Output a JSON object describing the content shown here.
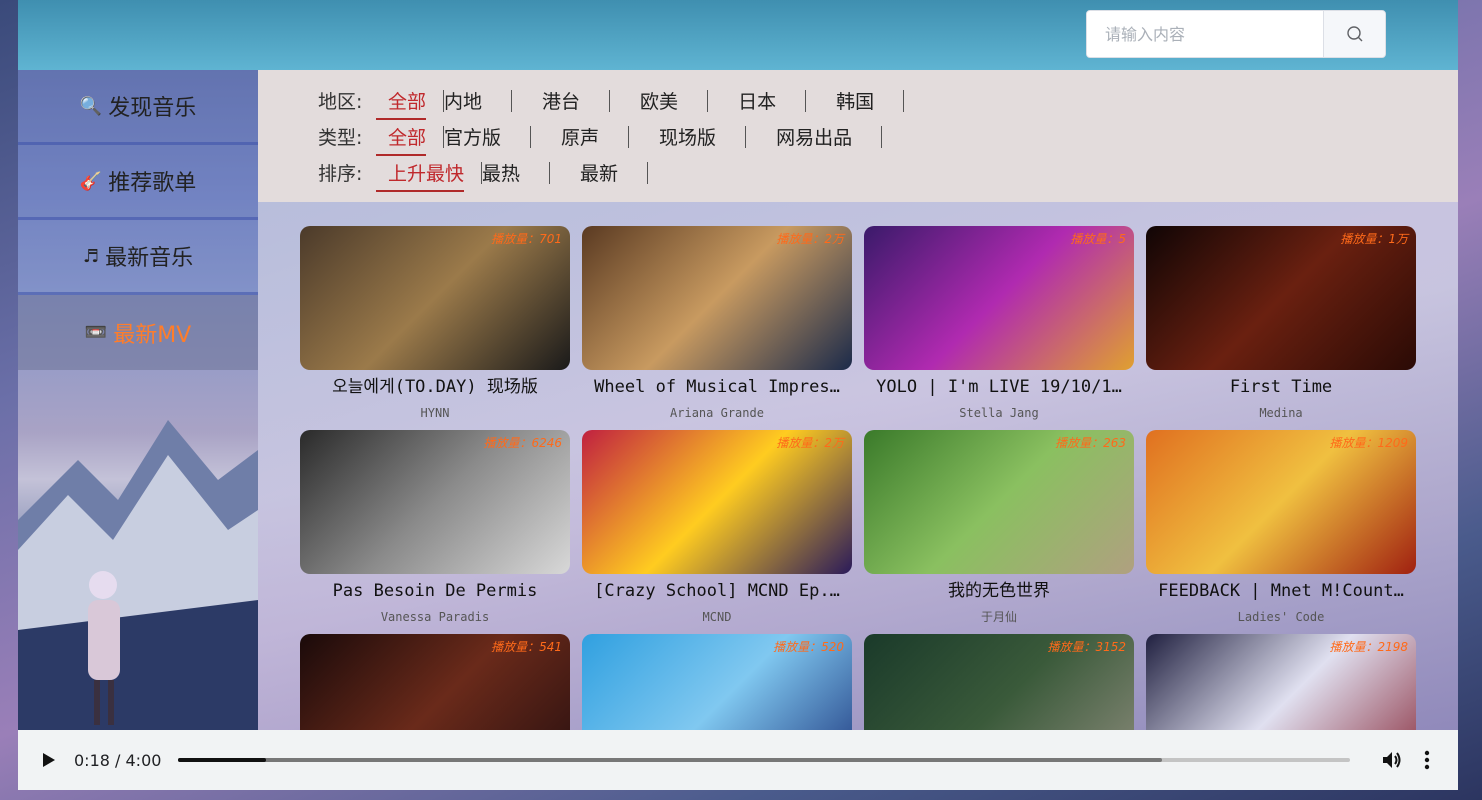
{
  "search": {
    "placeholder": "请输入内容",
    "icon": "search-icon"
  },
  "sidebar": {
    "items": [
      {
        "label": "发现音乐",
        "icon": "search-icon",
        "glyph": "🔍",
        "active": false
      },
      {
        "label": "推荐歌单",
        "icon": "guitar-icon",
        "glyph": "🎸",
        "active": false
      },
      {
        "label": "最新音乐",
        "icon": "music-note-icon",
        "glyph": "♬",
        "active": false
      },
      {
        "label": "最新MV",
        "icon": "video-icon",
        "glyph": "📼",
        "active": true
      }
    ]
  },
  "filters": {
    "area": {
      "label": "地区:",
      "options": [
        "全部",
        "内地",
        "港台",
        "欧美",
        "日本",
        "韩国"
      ],
      "selected": 0
    },
    "type": {
      "label": "类型:",
      "options": [
        "全部",
        "官方版",
        "原声",
        "现场版",
        "网易出品"
      ],
      "selected": 0
    },
    "order": {
      "label": "排序:",
      "options": [
        "上升最快",
        "最热",
        "最新"
      ],
      "selected": 0
    }
  },
  "mvs": [
    {
      "title": "오늘에게(TO.DAY) 现场版",
      "artist": "HYNN",
      "play_count": "播放量：701",
      "colors": [
        "#4b3a2a",
        "#9b7a4a",
        "#1a1a1a"
      ]
    },
    {
      "title": "Wheel of Musical Impres…",
      "artist": "Ariana Grande",
      "play_count": "播放量：2万",
      "colors": [
        "#5a3a22",
        "#c89a60",
        "#1b2a4a"
      ]
    },
    {
      "title": "YOLO | I'm LIVE 19/10/1…",
      "artist": "Stella Jang",
      "play_count": "播放量：5",
      "colors": [
        "#3a1a6a",
        "#b02ab0",
        "#e0a030"
      ]
    },
    {
      "title": "First Time",
      "artist": "Medina",
      "play_count": "播放量：1万",
      "colors": [
        "#100505",
        "#6a2010",
        "#2a0a05"
      ]
    },
    {
      "title": "Pas Besoin De Permis",
      "artist": "Vanessa Paradis",
      "play_count": "播放量：6246",
      "colors": [
        "#2a2a2a",
        "#8a8a8a",
        "#d8d8d8"
      ]
    },
    {
      "title": "[Crazy School] MCND Ep.…",
      "artist": "MCND",
      "play_count": "播放量：2万",
      "colors": [
        "#c02040",
        "#ffcc20",
        "#2a1a5a"
      ]
    },
    {
      "title": "我的无色世界",
      "artist": "于月仙",
      "play_count": "播放量：263",
      "colors": [
        "#3a7a2a",
        "#8ac060",
        "#b0a080"
      ]
    },
    {
      "title": "FEEDBACK | Mnet M!Count…",
      "artist": "Ladies' Code",
      "play_count": "播放量：1209",
      "colors": [
        "#e07020",
        "#f0c040",
        "#a02010"
      ]
    },
    {
      "title": "",
      "artist": "",
      "play_count": "播放量：541",
      "colors": [
        "#1a0a0a",
        "#6a2a1a",
        "#2a1010"
      ]
    },
    {
      "title": "",
      "artist": "",
      "play_count": "播放量：520",
      "colors": [
        "#30a0e0",
        "#80c8f0",
        "#203a80"
      ]
    },
    {
      "title": "",
      "artist": "",
      "play_count": "播放量：3152",
      "colors": [
        "#1a3a2a",
        "#3a5a3a",
        "#8a8a7a"
      ]
    },
    {
      "title": "",
      "artist": "",
      "play_count": "播放量：2198",
      "colors": [
        "#202040",
        "#e0e0f0",
        "#8a3040"
      ]
    }
  ],
  "player": {
    "time": "0:18 / 4:00",
    "progress": 0.075,
    "buffered": 0.84
  }
}
